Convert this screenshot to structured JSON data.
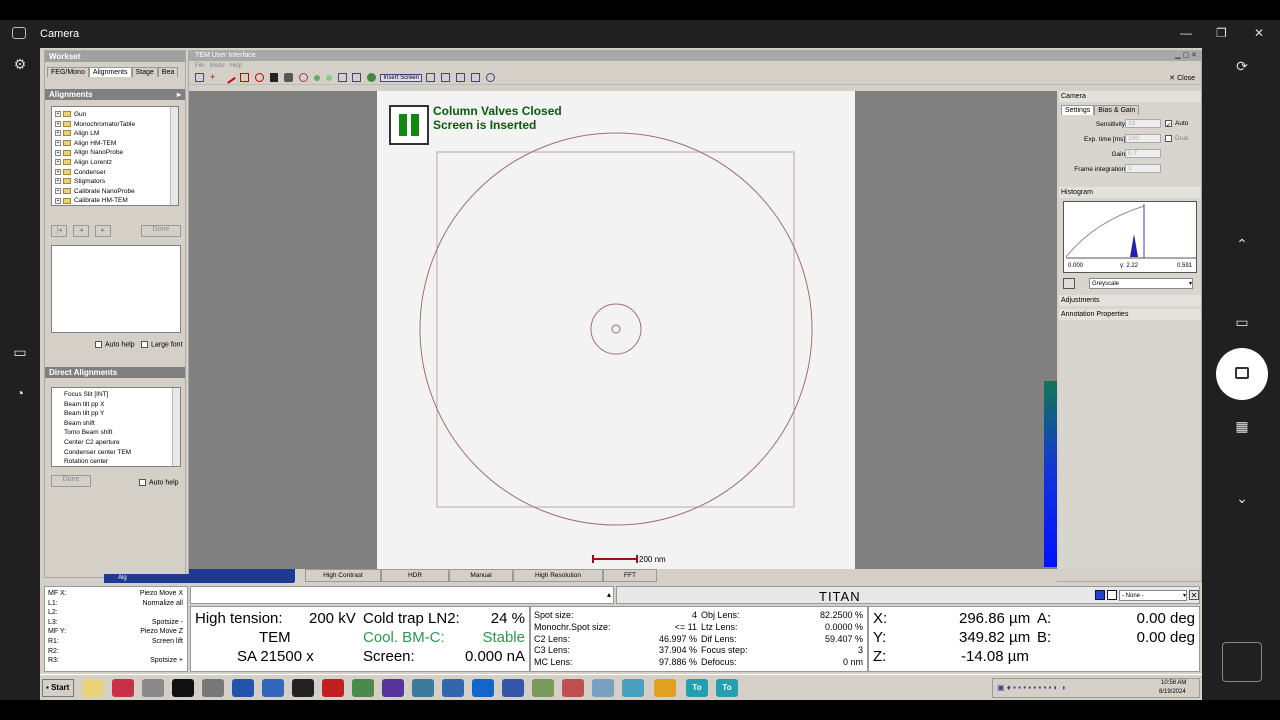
{
  "app": {
    "title": "Camera"
  },
  "workset": {
    "title": "Workset",
    "tabs": [
      "FEG/Mono",
      "Alignments",
      "Stage",
      "Bea"
    ],
    "active_tab": "Alignments"
  },
  "alignments": {
    "title": "Alignments",
    "items": [
      "Gun",
      "MonochromatorTable",
      "Align LM",
      "Align HM-TEM",
      "Align NanoProbe",
      "Align Lorentz",
      "Condenser",
      "Stigmators",
      "Calibrate NanoProbe",
      "Calibrate HM-TEM"
    ],
    "done_label": "Done",
    "auto_help": "Auto help",
    "large_font": "Large font"
  },
  "direct_alignments": {
    "title": "Direct Alignments",
    "items": [
      "Focus Slit  [INT]",
      "Beam tilt pp X",
      "Beam tilt pp Y",
      "Beam shift",
      "Tomo Beam shift",
      "Center C2 aperture",
      "Condenser center TEM",
      "Rotation center"
    ],
    "done_label": "Done",
    "auto_help": "Auto help"
  },
  "tem_window": {
    "title": "TEM User Interface",
    "menu": [
      "File",
      "Mode",
      "Help"
    ],
    "insert_screen": "Insert Screen",
    "close": "Close"
  },
  "viewer": {
    "status_line1": "Column Valves Closed",
    "status_line2": "Screen is Inserted",
    "scale_label": "200 nm"
  },
  "camera_panel": {
    "title": "Camera",
    "tabs": [
      "Settings",
      "Bias & Gain"
    ],
    "sensitivity_label": "Sensitivity:",
    "sensitivity_value": "10",
    "auto_label": "Auto",
    "exp_label": "Exp. time [ms]:",
    "exp_value": "100",
    "dual_label": "Dual",
    "gain_label": "Gain:",
    "gain_value": "0.7",
    "frame_label": "Frame integration:",
    "frame_value": "1"
  },
  "histogram": {
    "title": "Histogram",
    "min": "0.000",
    "gamma": "γ: 2.22",
    "max": "0.591",
    "mode": "Greyscale"
  },
  "side_sections": [
    "Adjustments",
    "Annotation Properties"
  ],
  "bottom_tabs": [
    "High Contrast",
    "HDR",
    "Manual",
    "High Resolution",
    "FFT"
  ],
  "left_status_task": "Alg",
  "mf_list": {
    "left": [
      "MF X:",
      "L1:",
      "L2:",
      "L3:",
      "MF Y:",
      "R1:",
      "R2:",
      "R3:"
    ],
    "right": [
      "Piezo Move X",
      "Normalize all",
      "",
      "Spotsize -",
      "Piezo Move Z",
      "Screen lift",
      "",
      "Spotsize +"
    ]
  },
  "titan": {
    "label": "TITAN",
    "none_option": "- None -"
  },
  "status": {
    "ht_label": "High tension:",
    "ht_value": "200 kV",
    "ctrap_label": "Cold trap LN2:",
    "ctrap_value": "24 %",
    "mode": "TEM",
    "cool_label": "Cool. BM-C:",
    "cool_value": "Stable",
    "mag": "SA 21500 x",
    "screen_label": "Screen:",
    "screen_value": "0.000 nA"
  },
  "lens": {
    "left": [
      {
        "label": "Spot size:",
        "value": "4"
      },
      {
        "label": "Monochr.Spot size:",
        "value": "<= 11"
      },
      {
        "label": "C2 Lens:",
        "value": "46.997 %"
      },
      {
        "label": "C3 Lens:",
        "value": "37.904 %"
      },
      {
        "label": "MC Lens:",
        "value": "97.886 %"
      }
    ],
    "right": [
      {
        "label": "Obj Lens:",
        "value": "82.2500 %"
      },
      {
        "label": "Ltz Lens:",
        "value": "0.0000 %"
      },
      {
        "label": "Dif Lens:",
        "value": "59.407 %"
      },
      {
        "label": "Focus step:",
        "value": "3"
      },
      {
        "label": "Defocus:",
        "value": "0 nm"
      }
    ]
  },
  "stage": {
    "x_label": "X:",
    "x_value": "296.86 µm",
    "y_label": "Y:",
    "y_value": "349.82 µm",
    "z_label": "Z:",
    "z_value": "-14.08 µm",
    "a_label": "A:",
    "a_value": "0.00 deg",
    "b_label": "B:",
    "b_value": "0.00 deg"
  },
  "taskbar": {
    "start": "Start",
    "time": "10:58 AM",
    "date": "8/19/2024",
    "tile_label": "To"
  }
}
